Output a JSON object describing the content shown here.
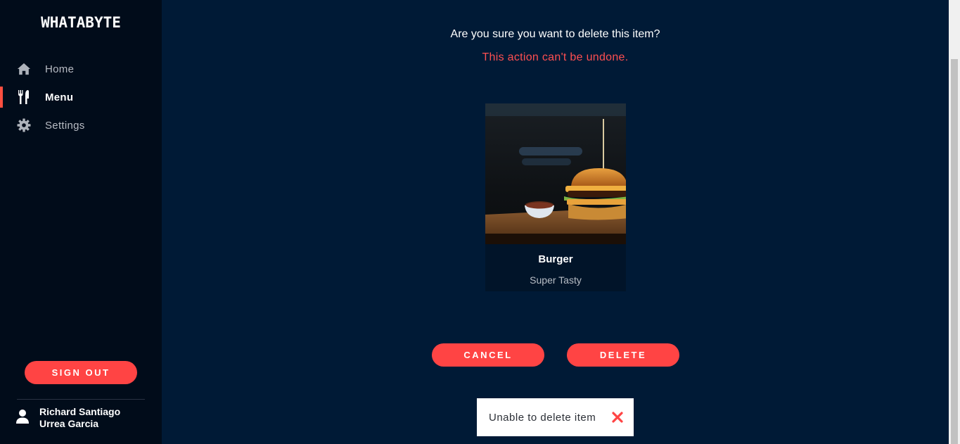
{
  "app": {
    "brand": "WHATABYTE"
  },
  "sidebar": {
    "items": [
      {
        "label": "Home",
        "icon": "home-icon",
        "active": false
      },
      {
        "label": "Menu",
        "icon": "utensils-icon",
        "active": true
      },
      {
        "label": "Settings",
        "icon": "gear-icon",
        "active": false
      }
    ],
    "sign_out_label": "SIGN OUT",
    "user": {
      "name_line1": "Richard Santiago",
      "name_line2": "Urrea Garcia",
      "icon": "user-icon"
    }
  },
  "dialog": {
    "question": "Are you sure you want to delete this item?",
    "warning": "This action can't be undone.",
    "item": {
      "name": "Burger",
      "description": "Super Tasty"
    },
    "cancel_label": "CANCEL",
    "delete_label": "DELETE"
  },
  "toast": {
    "message": "Unable to delete item",
    "icon": "close-icon"
  },
  "colors": {
    "accent": "#ff4444",
    "background": "#001a36",
    "sidebar": "#010c1a",
    "warning": "#ff4f51"
  }
}
